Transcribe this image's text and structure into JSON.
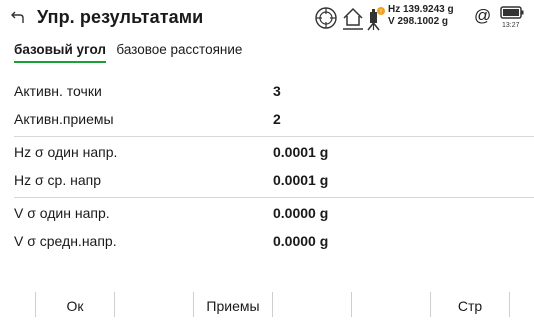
{
  "header": {
    "title": "Упр. результатами",
    "hz_reading": "Hz 139.9243 g",
    "v_reading": "V   298.1002 g",
    "time": "13:27",
    "icons": [
      "back-icon",
      "target-icon",
      "home-icon",
      "robot-instrument-icon",
      "at-icon",
      "battery-icon"
    ]
  },
  "tabs": [
    {
      "label": "базовый угол",
      "active": true
    },
    {
      "label": "базовое расстояние",
      "active": false
    }
  ],
  "groups": [
    [
      {
        "label": "Активн. точки",
        "value": "3"
      },
      {
        "label": "Активн.приемы",
        "value": "2"
      }
    ],
    [
      {
        "label": "Hz σ один напр.",
        "value": "0.0001 g"
      },
      {
        "label": "Hz σ ср. напр",
        "value": "0.0001 g"
      }
    ],
    [
      {
        "label": "V σ один напр.",
        "value": "0.0000 g"
      },
      {
        "label": "V σ средн.напр.",
        "value": "0.0000 g"
      }
    ]
  ],
  "footer": {
    "ok_label": "Ок",
    "sets_label": "Приемы",
    "page_label": "Стр"
  },
  "colors": {
    "accent": "#1a9f3a",
    "status_dot": "#f0a020"
  }
}
